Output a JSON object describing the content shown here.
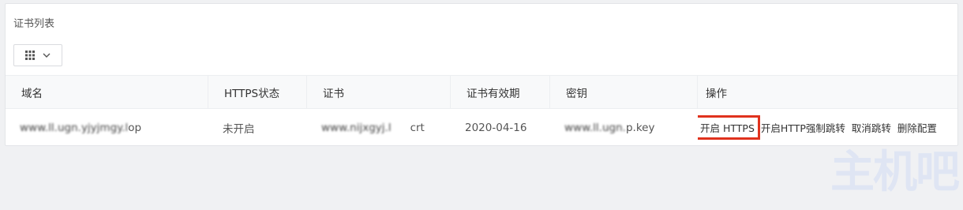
{
  "panel": {
    "title": "证书列表"
  },
  "view_toggle": {
    "icon": "grid-icon",
    "caret": "chevron-down-icon"
  },
  "table": {
    "columns": [
      "域名",
      "HTTPS状态",
      "证书",
      "证书有效期",
      "密钥",
      "操作"
    ],
    "rows": [
      {
        "domain_blurred": "www.ll.ugn.yjyjmgy.l",
        "domain_suffix": "op",
        "https_status": "未开启",
        "cert_blurred": "www.nijxgyj.l",
        "cert_suffix": "crt",
        "expiry": "2020-04-16",
        "key_blurred": "www.ll.ugn.",
        "key_suffix": "p.key",
        "actions": {
          "enable_https": "开启 HTTPS",
          "force_redirect": "开启HTTP强制跳转",
          "cancel_redirect": "取消跳转",
          "delete_config": "删除配置"
        }
      }
    ]
  },
  "watermark": "主机吧",
  "colors": {
    "highlight_border": "#e0321d",
    "header_bg": "#f8f9fa",
    "watermark": "#dfe5f3"
  }
}
